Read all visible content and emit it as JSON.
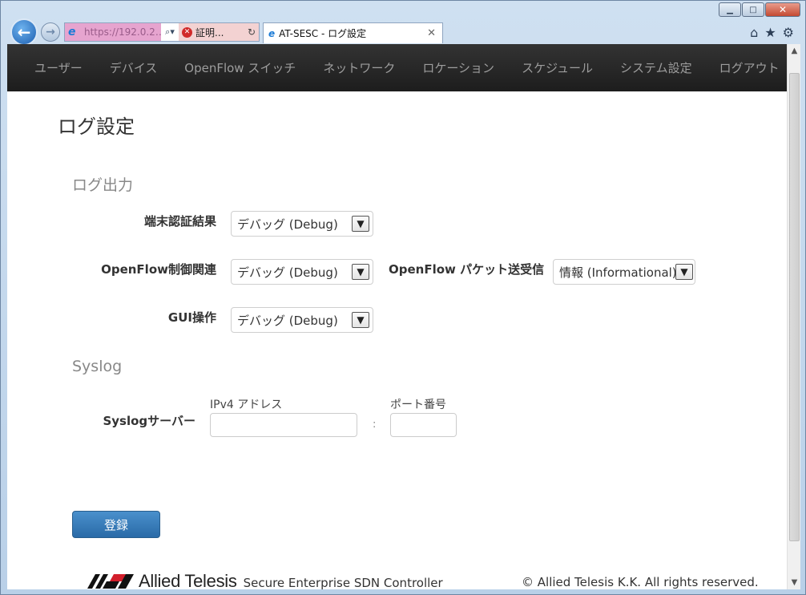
{
  "browser": {
    "address_url": "https://192.0.2…",
    "cert_error_label": "証明...",
    "tab_title": "AT-SESC - ログ設定"
  },
  "nav": {
    "items": [
      "ユーザー",
      "デバイス",
      "OpenFlow スイッチ",
      "ネットワーク",
      "ロケーション",
      "スケジュール",
      "システム設定"
    ],
    "logout": "ログアウト"
  },
  "page": {
    "title": "ログ設定",
    "log_section": "ログ出力",
    "fields": {
      "terminal_auth": {
        "label": "端末認証結果",
        "value": "デバッグ (Debug)"
      },
      "openflow_control": {
        "label": "OpenFlow制御関連",
        "value": "デバッグ (Debug)"
      },
      "openflow_packet": {
        "label": "OpenFlow パケット送受信",
        "value": "情報 (Informational)"
      },
      "gui_operation": {
        "label": "GUI操作",
        "value": "デバッグ (Debug)"
      }
    },
    "syslog_section": "Syslog",
    "syslog": {
      "label": "Syslogサーバー",
      "ipv4_label": "IPv4 アドレス",
      "port_label": "ポート番号",
      "ipv4_value": "",
      "port_value": "",
      "separator": ":"
    },
    "submit": "登録"
  },
  "footer": {
    "brand": "Allied Telesis",
    "product": "Secure Enterprise SDN Controller",
    "copyright": "© Allied Telesis K.K. All rights reserved."
  }
}
